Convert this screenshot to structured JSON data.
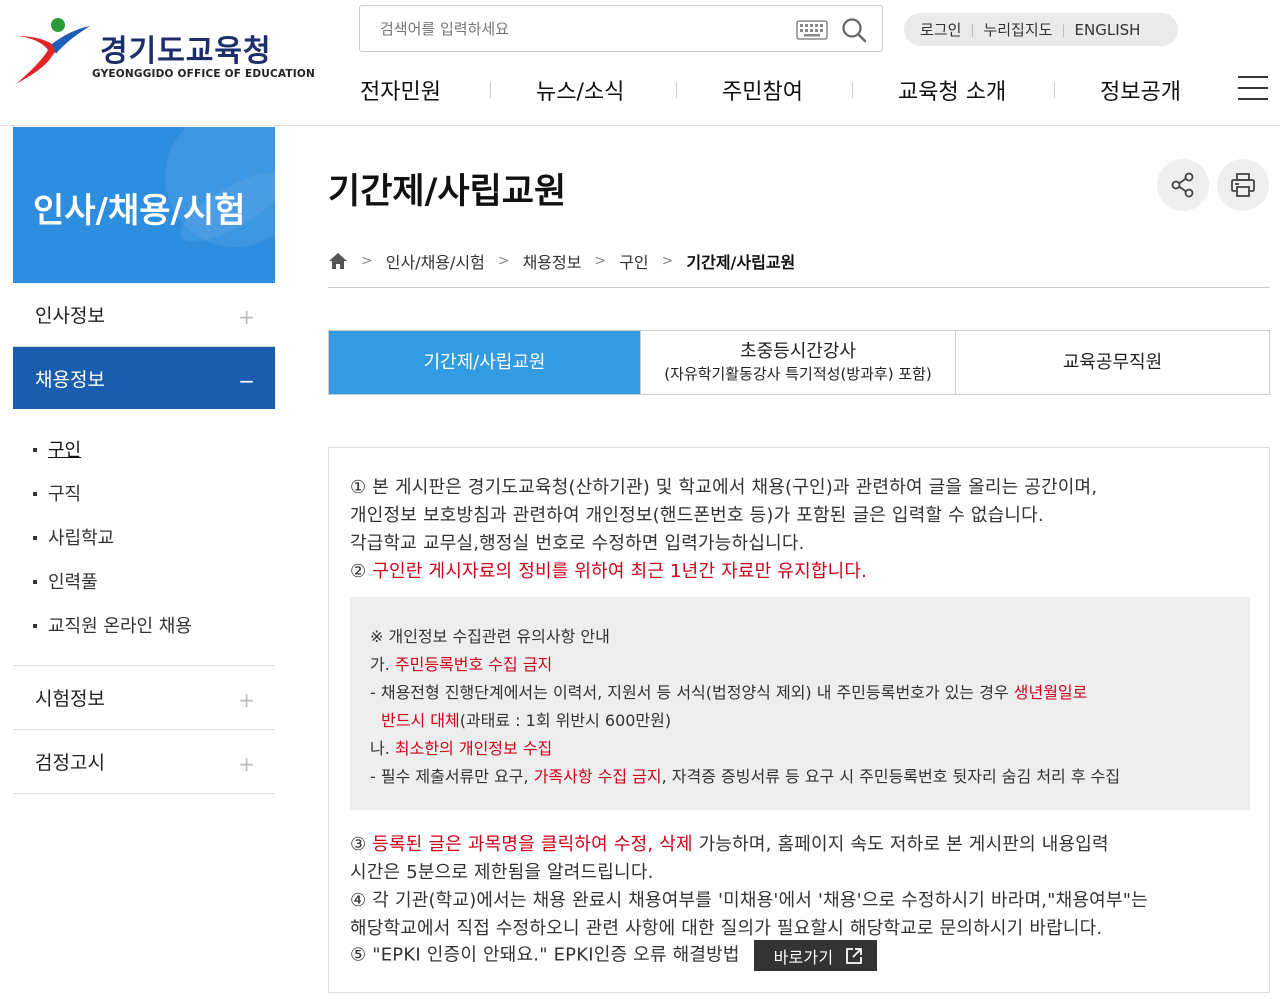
{
  "header": {
    "logo_text": "경기도교육청",
    "logo_sub": "GYEONGGIDO OFFICE OF EDUCATION",
    "search_placeholder": "검색어를 입력하세요",
    "util": [
      "로그인",
      "누리집지도",
      "ENGLISH"
    ],
    "gnb": [
      "전자민원",
      "뉴스/소식",
      "주민참여",
      "교육청 소개",
      "정보공개"
    ]
  },
  "sidebar": {
    "title": "인사/채용/시험",
    "items": [
      {
        "label": "인사정보",
        "toggle": "+"
      },
      {
        "label": "채용정보",
        "toggle": "−"
      },
      {
        "label": "시험정보",
        "toggle": "+"
      },
      {
        "label": "검정고시",
        "toggle": "+"
      }
    ],
    "sub_items": [
      "구인",
      "구직",
      "사립학교",
      "인력풀",
      "교직원 온라인 채용"
    ]
  },
  "content": {
    "title": "기간제/사립교원",
    "breadcrumb": [
      "인사/채용/시험",
      "채용정보",
      "구인",
      "기간제/사립교원"
    ],
    "tabs": [
      {
        "label": "기간제/사립교원",
        "sub": ""
      },
      {
        "label": "초중등시간강사",
        "sub": "(자유학기활동강사 특기적성(방과후) 포함)"
      },
      {
        "label": "교육공무직원",
        "sub": ""
      }
    ]
  },
  "notice": {
    "l1": "① 본 게시판은 경기도교육청(산하기관) 및 학교에서 채용(구인)과 관련하여 글을 올리는 공간이며,",
    "l2": "개인정보 보호방침과 관련하여 개인정보(핸드폰번호 등)가 포함된 글은 입력할 수 없습니다.",
    "l3": "각급학교 교무실,행정실 번호로 수정하면 입력가능하십니다.",
    "l4_prefix": "② ",
    "l4_red": "구인란 게시자료의 정비를 위하여 최근 1년간 자료만 유지합니다.",
    "box": {
      "t1": "※ 개인정보 수집관련 유의사항 안내",
      "t2_prefix": "가. ",
      "t2_red": "주민등록번호 수집 금지",
      "t3_a": "- 채용전형 진행단계에서는 이력서, 지원서 등 서식(법정양식 제외) 내 주민등록번호가 있는 경우 ",
      "t3_red": "생년월일로",
      "t4_red": "반드시 대체",
      "t4_b": "(과태료 : 1회 위반시 600만원)",
      "t5_prefix": "나. ",
      "t5_red": "최소한의 개인정보 수집",
      "t6_a": "- 필수 제출서류만 요구, ",
      "t6_red": "가족사항 수집 금지",
      "t6_b": ", 자격증 증빙서류 등 요구 시 주민등록번호 뒷자리 숨김 처리 후 수집"
    },
    "l5_prefix": "③ ",
    "l5_red": "등록된 글은 과목명을 클릭하여 수정, 삭제",
    "l5_b": " 가능하며, 홈페이지 속도 저하로 본 게시판의 내용입력",
    "l6": "시간은 5분으로 제한됨을 알려드립니다.",
    "l7": "④ 각 기관(학교)에서는 채용 완료시 채용여부를 '미채용'에서 '채용'으로 수정하시기 바라며,\"채용여부\"는",
    "l8": "해당학교에서 직접 수정하오니 관련 사항에 대한 질의가 필요할시 해당학교로 문의하시기 바랍니다.",
    "l9": "⑤ \"EPKI 인증이 안돼요.\" EPKI인증 오류 해결방법",
    "goto_label": "바로가기"
  },
  "colors": {
    "brand_blue": "#1a5cad",
    "tab_blue": "#339be2",
    "banner_blue": "#2d8ee0",
    "alert_red": "#d0021b"
  }
}
